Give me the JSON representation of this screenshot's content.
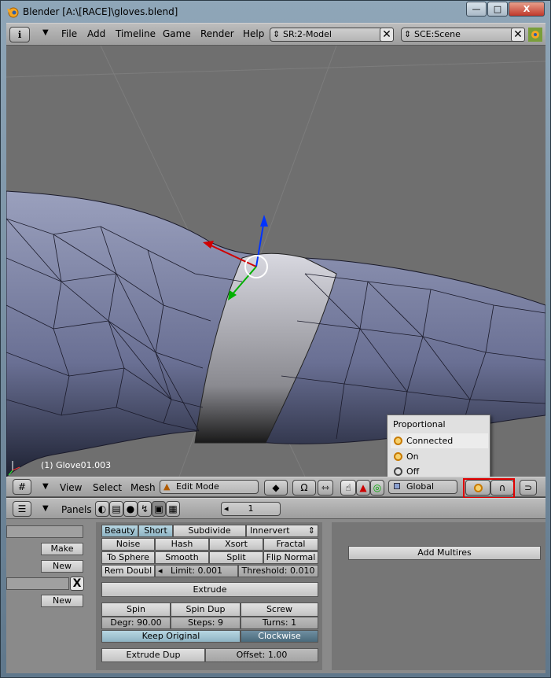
{
  "window": {
    "title": "Blender [A:\\[RACE]\\gloves.blend]",
    "minimize": "—",
    "maximize": "□",
    "close": "X"
  },
  "info_header": {
    "menus": [
      "File",
      "Add",
      "Timeline",
      "Game",
      "Render",
      "Help"
    ],
    "screen_field": "SR:2-Model",
    "scene_field": "SCE:Scene"
  },
  "viewport": {
    "object_label": "(1) Glove01.003"
  },
  "proportional_popup": {
    "title": "Proportional",
    "items": [
      "Connected",
      "On",
      "Off"
    ]
  },
  "view3d_header": {
    "menus": [
      "View",
      "Select",
      "Mesh"
    ],
    "mode": "Edit Mode",
    "orientation": "Global"
  },
  "buttons_header": {
    "panels_label": "Panels",
    "frame": "1"
  },
  "left_column": {
    "make": "Make",
    "new1": "New",
    "new2": "New",
    "x": "X"
  },
  "mesh_tools": {
    "beauty": "Beauty",
    "short": "Short",
    "subdivide": "Subdivide",
    "innervert": "Innervert",
    "noise": "Noise",
    "hash": "Hash",
    "xsort": "Xsort",
    "fractal": "Fractal",
    "to_sphere": "To Sphere",
    "smooth": "Smooth",
    "split": "Split",
    "flip_normal": "Flip Normal",
    "rem_doubl": "Rem Doubl",
    "limit": "Limit: 0.001",
    "threshold": "Threshold: 0.010",
    "extrude": "Extrude",
    "spin": "Spin",
    "spin_dup": "Spin Dup",
    "screw": "Screw",
    "degr": "Degr: 90.00",
    "steps": "Steps: 9",
    "turns": "Turns: 1",
    "keep_original": "Keep Original",
    "clockwise": "Clockwise",
    "extrude_dup": "Extrude Dup",
    "offset": "Offset: 1.00"
  },
  "multires": {
    "add": "Add Multires"
  },
  "colors": {
    "accent_orange": "#ff8a00",
    "annotation_red": "#e00000",
    "mesh_blue": "#8088a8"
  }
}
